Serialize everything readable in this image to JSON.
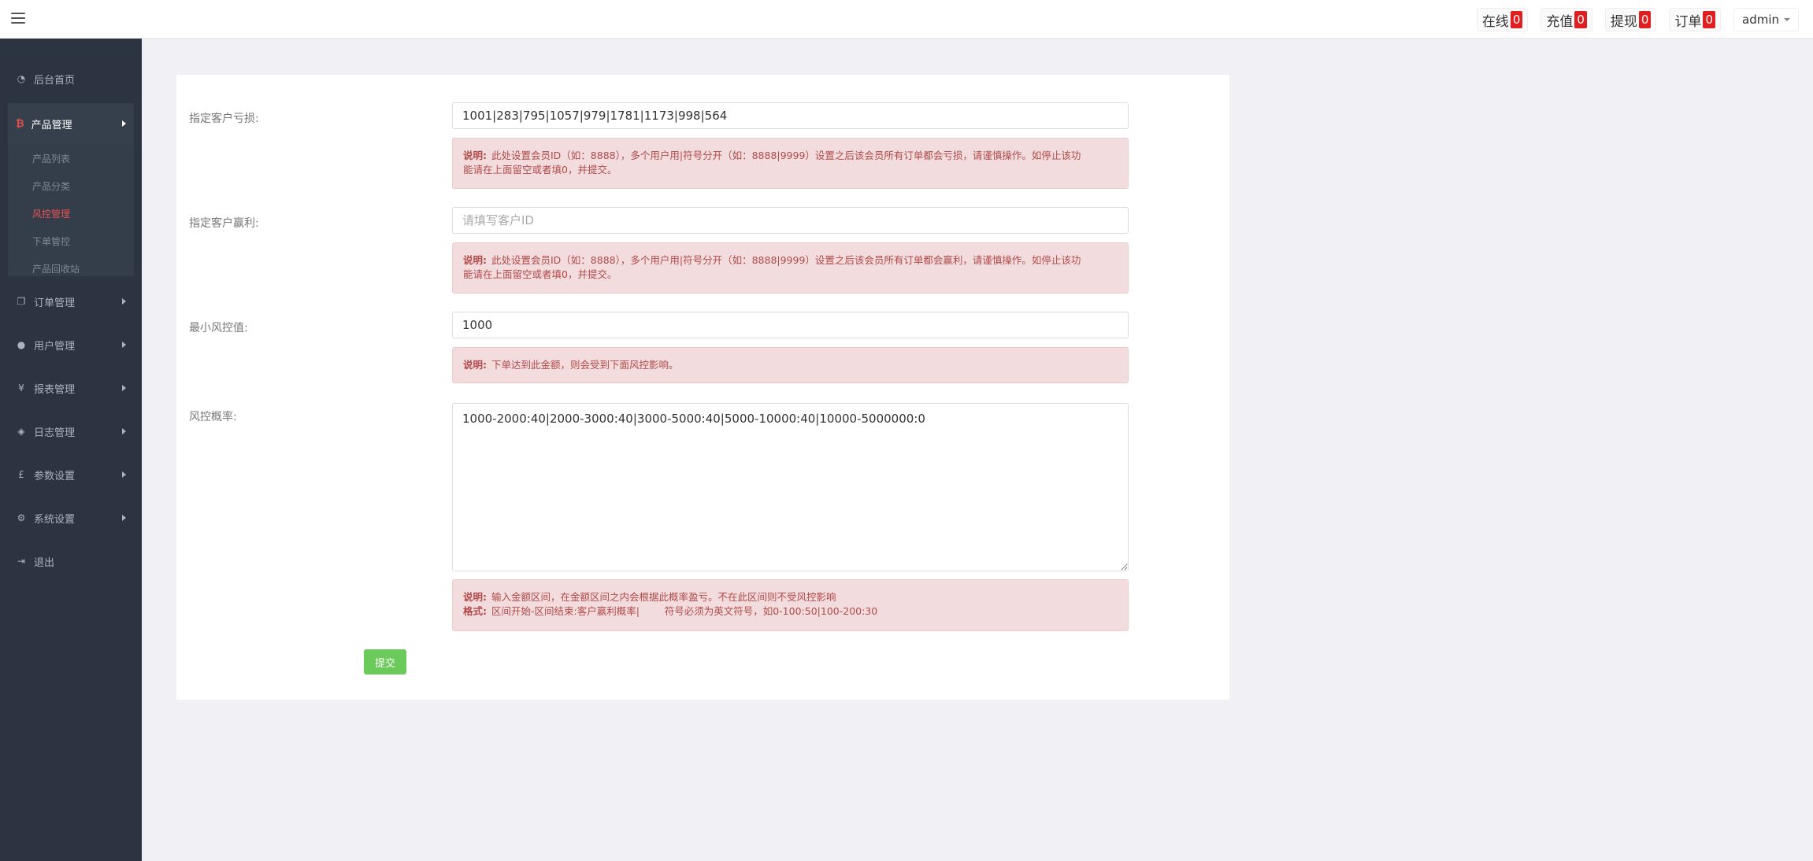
{
  "header": {
    "stats": [
      {
        "label": "在线",
        "count": "0"
      },
      {
        "label": "充值",
        "count": "0"
      },
      {
        "label": "提现",
        "count": "0"
      },
      {
        "label": "订单",
        "count": "0"
      }
    ],
    "user": "admin"
  },
  "sidebar": {
    "home": "后台首页",
    "product_group": {
      "label": "产品管理",
      "items": [
        "产品列表",
        "产品分类",
        "风控管理",
        "下单管控",
        "产品回收站"
      ],
      "active_index": 2
    },
    "items": [
      "订单管理",
      "用户管理",
      "报表管理",
      "日志管理",
      "参数设置",
      "系统设置",
      "退出"
    ]
  },
  "form": {
    "loss": {
      "label": "指定客户亏损:",
      "value": "1001|283|795|1057|979|1781|1173|998|564",
      "note_title": "说明:",
      "note_line1": "此处设置会员ID（如：8888），多个用户用|符号分开（如：8888|9999）设置之后该会员所有订单都会亏损，请谨慎操作。如停止该功",
      "note_line2": "能请在上面留空或者填0，并提交。"
    },
    "profit": {
      "label": "指定客户赢利:",
      "value": "",
      "placeholder": "请填写客户ID",
      "note_title": "说明:",
      "note_line1": "此处设置会员ID（如：8888），多个用户用|符号分开（如：8888|9999）设置之后该会员所有订单都会赢利，请谨慎操作。如停止该功",
      "note_line2": "能请在上面留空或者填0，并提交。"
    },
    "min_risk": {
      "label": "最小风控值:",
      "value": "1000",
      "note_title": "说明:",
      "note_line1": "下单达到此金额，则会受到下面风控影响。"
    },
    "risk_rate": {
      "label": "风控概率:",
      "value": "1000-2000:40|2000-3000:40|3000-5000:40|5000-10000:40|10000-5000000:0",
      "note_title": "说明:",
      "note_line1": "输入金额区间，在金额区间之内会根据此概率盈亏。不在此区间则不受风控影响",
      "note_title2": "格式:",
      "note_line2": "区间开始-区间结束:客户赢利概率|        符号必须为英文符号，如0-100:50|100-200:30"
    },
    "submit_label": "提交"
  }
}
